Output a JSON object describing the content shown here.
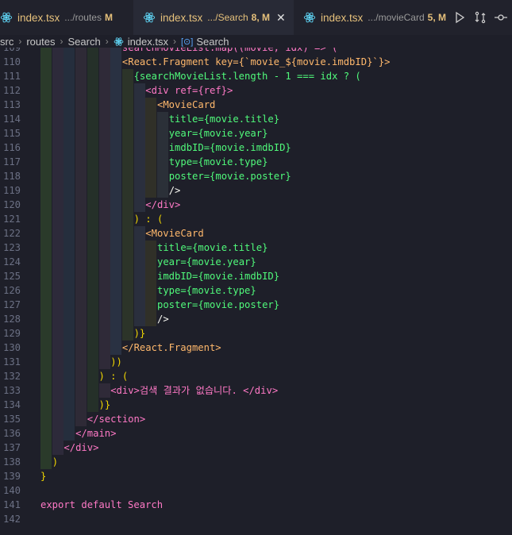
{
  "tabs": [
    {
      "name": "index.tsx",
      "path": ".../routes",
      "badge": "M",
      "active": false
    },
    {
      "name": "index.tsx",
      "path": ".../Search",
      "badge": "8, M",
      "active": true
    },
    {
      "name": "index.tsx",
      "path": ".../movieCard",
      "badge": "5, M",
      "active": false
    }
  ],
  "breadcrumb": {
    "parts": [
      "src",
      "routes",
      "Search",
      "index.tsx"
    ],
    "symbol": "Search"
  },
  "colors": {
    "tab_modified": "#e5c07b",
    "icon": "#61dafb"
  },
  "lines": [
    {
      "n": "109",
      "partial": "searchMovieList.map((movie, idx) => ("
    },
    {
      "n": "110",
      "a": "<",
      "b": "React.Fragment",
      "c": " key=",
      "d": "{`movie_${movie.imdbID}`}",
      "e": ">"
    },
    {
      "n": "111",
      "text": "{searchMovieList.length - 1 === idx ? ("
    },
    {
      "n": "112",
      "text": "<div ref={ref}>"
    },
    {
      "n": "113",
      "text": "<MovieCard"
    },
    {
      "n": "114",
      "text": "title={movie.title}"
    },
    {
      "n": "115",
      "text": "year={movie.year}"
    },
    {
      "n": "116",
      "text": "imdbID={movie.imdbID}"
    },
    {
      "n": "117",
      "text": "type={movie.type}"
    },
    {
      "n": "118",
      "text": "poster={movie.poster}"
    },
    {
      "n": "119",
      "text": "/>"
    },
    {
      "n": "120",
      "text": "</div>"
    },
    {
      "n": "121",
      "text": ") : ("
    },
    {
      "n": "122",
      "text": "<MovieCard"
    },
    {
      "n": "123",
      "text": "title={movie.title}"
    },
    {
      "n": "124",
      "text": "year={movie.year}"
    },
    {
      "n": "125",
      "text": "imdbID={movie.imdbID}"
    },
    {
      "n": "126",
      "text": "type={movie.type}"
    },
    {
      "n": "127",
      "text": "poster={movie.poster}"
    },
    {
      "n": "128",
      "text": "/>"
    },
    {
      "n": "129",
      "text": ")}"
    },
    {
      "n": "130",
      "text": "</React.Fragment>"
    },
    {
      "n": "131",
      "text": "))"
    },
    {
      "n": "132",
      "text": ") : ("
    },
    {
      "n": "133",
      "text": "<div>검색 결과가 없습니다. </div>"
    },
    {
      "n": "134",
      "text": ")}"
    },
    {
      "n": "135",
      "text": "</section>"
    },
    {
      "n": "136",
      "text": "</main>"
    },
    {
      "n": "137",
      "text": "</div>"
    },
    {
      "n": "138",
      "text": ")"
    },
    {
      "n": "139",
      "text": "}"
    },
    {
      "n": "140",
      "text": ""
    },
    {
      "n": "141",
      "text": "export default Search"
    },
    {
      "n": "142",
      "text": ""
    }
  ]
}
